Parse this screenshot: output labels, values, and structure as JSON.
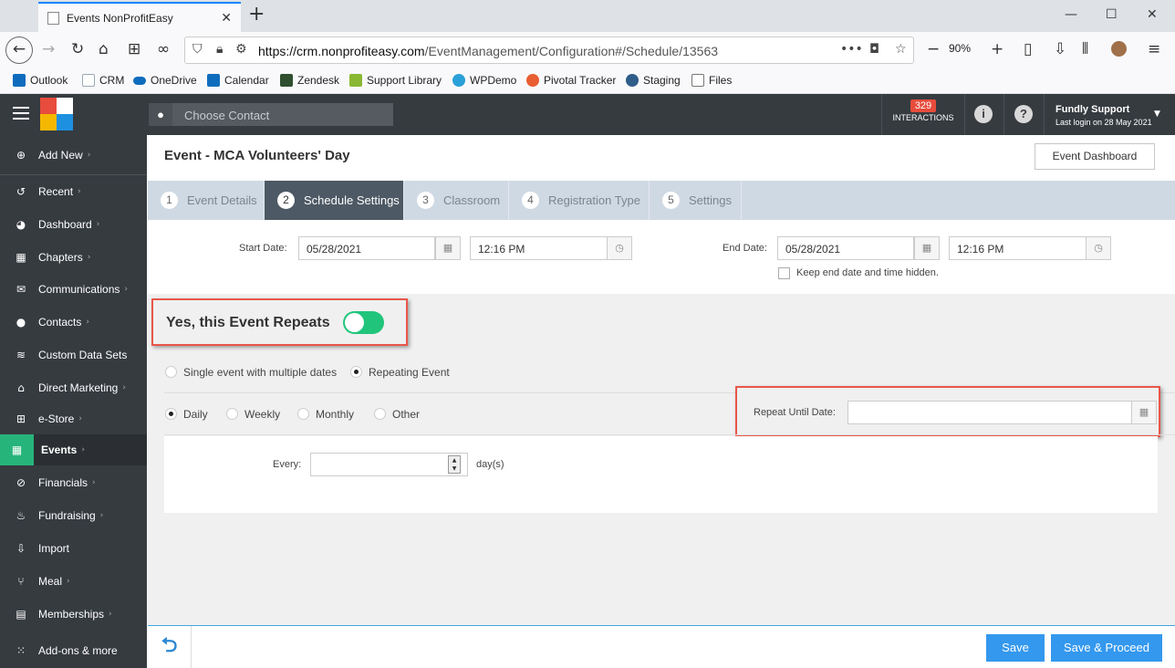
{
  "browser": {
    "tab_title": "Events NonProfitEasy",
    "url_host": "https://crm.nonprofiteasy.com",
    "url_path": "/EventManagement/Configuration#/Schedule/13563",
    "zoom": "90%",
    "bookmarks": [
      {
        "label": "Outlook",
        "color": "#0f6cbd"
      },
      {
        "label": "CRM",
        "color": "#9aa7b5"
      },
      {
        "label": "OneDrive",
        "color": "#0f6cbd"
      },
      {
        "label": "Calendar",
        "color": "#0f6cbd"
      },
      {
        "label": "Zendesk",
        "color": "#2f4f2f"
      },
      {
        "label": "Support Library",
        "color": "#8ab833"
      },
      {
        "label": "WPDemo",
        "color": "#2aa0d8"
      },
      {
        "label": "Pivotal Tracker",
        "color": "#e85d32"
      },
      {
        "label": "Staging",
        "color": "#2f5d8a"
      },
      {
        "label": "Files",
        "color": "#777777"
      }
    ]
  },
  "header": {
    "search_placeholder": "Choose Contact",
    "interactions_count": "329",
    "interactions_label": "INTERACTIONS",
    "user_name": "Fundly Support",
    "last_login": "Last login on 28 May 2021"
  },
  "sidebar": {
    "items": [
      {
        "label": "Add New",
        "icon": "plus-circle-icon",
        "glyph": "⊕"
      },
      {
        "label": "Recent",
        "icon": "history-icon",
        "glyph": "↺"
      },
      {
        "label": "Dashboard",
        "icon": "dashboard-icon",
        "glyph": "◕"
      },
      {
        "label": "Chapters",
        "icon": "grid-icon",
        "glyph": "▦"
      },
      {
        "label": "Communications",
        "icon": "envelope-icon",
        "glyph": "✉"
      },
      {
        "label": "Contacts",
        "icon": "user-icon",
        "glyph": "●"
      },
      {
        "label": "Custom Data Sets",
        "icon": "layers-icon",
        "glyph": "≋"
      },
      {
        "label": "Direct Marketing",
        "icon": "mailbox-icon",
        "glyph": "⌂"
      },
      {
        "label": "e-Store",
        "icon": "cart-icon",
        "glyph": "⊞"
      },
      {
        "label": "Events",
        "icon": "calendar-icon",
        "glyph": "▦"
      },
      {
        "label": "Financials",
        "icon": "money-icon",
        "glyph": "⊘"
      },
      {
        "label": "Fundraising",
        "icon": "money-bag-icon",
        "glyph": "♨"
      },
      {
        "label": "Import",
        "icon": "import-icon",
        "glyph": "⇩"
      },
      {
        "label": "Meal",
        "icon": "utensils-icon",
        "glyph": "⑂"
      },
      {
        "label": "Memberships",
        "icon": "id-card-icon",
        "glyph": "▤"
      },
      {
        "label": "Add-ons & more",
        "icon": "apps-icon",
        "glyph": "⁙"
      }
    ]
  },
  "event": {
    "title": "Event - MCA Volunteers' Day",
    "dashboard_button": "Event Dashboard",
    "steps": [
      {
        "num": "1",
        "label": "Event Details"
      },
      {
        "num": "2",
        "label": "Schedule Settings"
      },
      {
        "num": "3",
        "label": "Classroom"
      },
      {
        "num": "4",
        "label": "Registration Type"
      },
      {
        "num": "5",
        "label": "Settings"
      }
    ],
    "start_date_label": "Start Date:",
    "start_date": "05/28/2021",
    "start_time": "12:16 PM",
    "end_date_label": "End Date:",
    "end_date": "05/28/2021",
    "end_time": "12:16 PM",
    "keep_hidden_label": "Keep end date and time hidden.",
    "repeat_toggle_label": "Yes, this Event Repeats",
    "mode_single": "Single event with multiple dates",
    "mode_repeating": "Repeating Event",
    "freq_daily": "Daily",
    "freq_weekly": "Weekly",
    "freq_monthly": "Monthly",
    "freq_other": "Other",
    "repeat_until_label": "Repeat Until Date:",
    "repeat_until_value": "",
    "every_label": "Every:",
    "every_value": "",
    "every_unit": "day(s)"
  },
  "footer": {
    "save": "Save",
    "save_proceed": "Save & Proceed"
  },
  "colors": {
    "accent_green": "#20c57b",
    "highlight_red": "#e9564a",
    "button_blue": "#3498ee"
  }
}
